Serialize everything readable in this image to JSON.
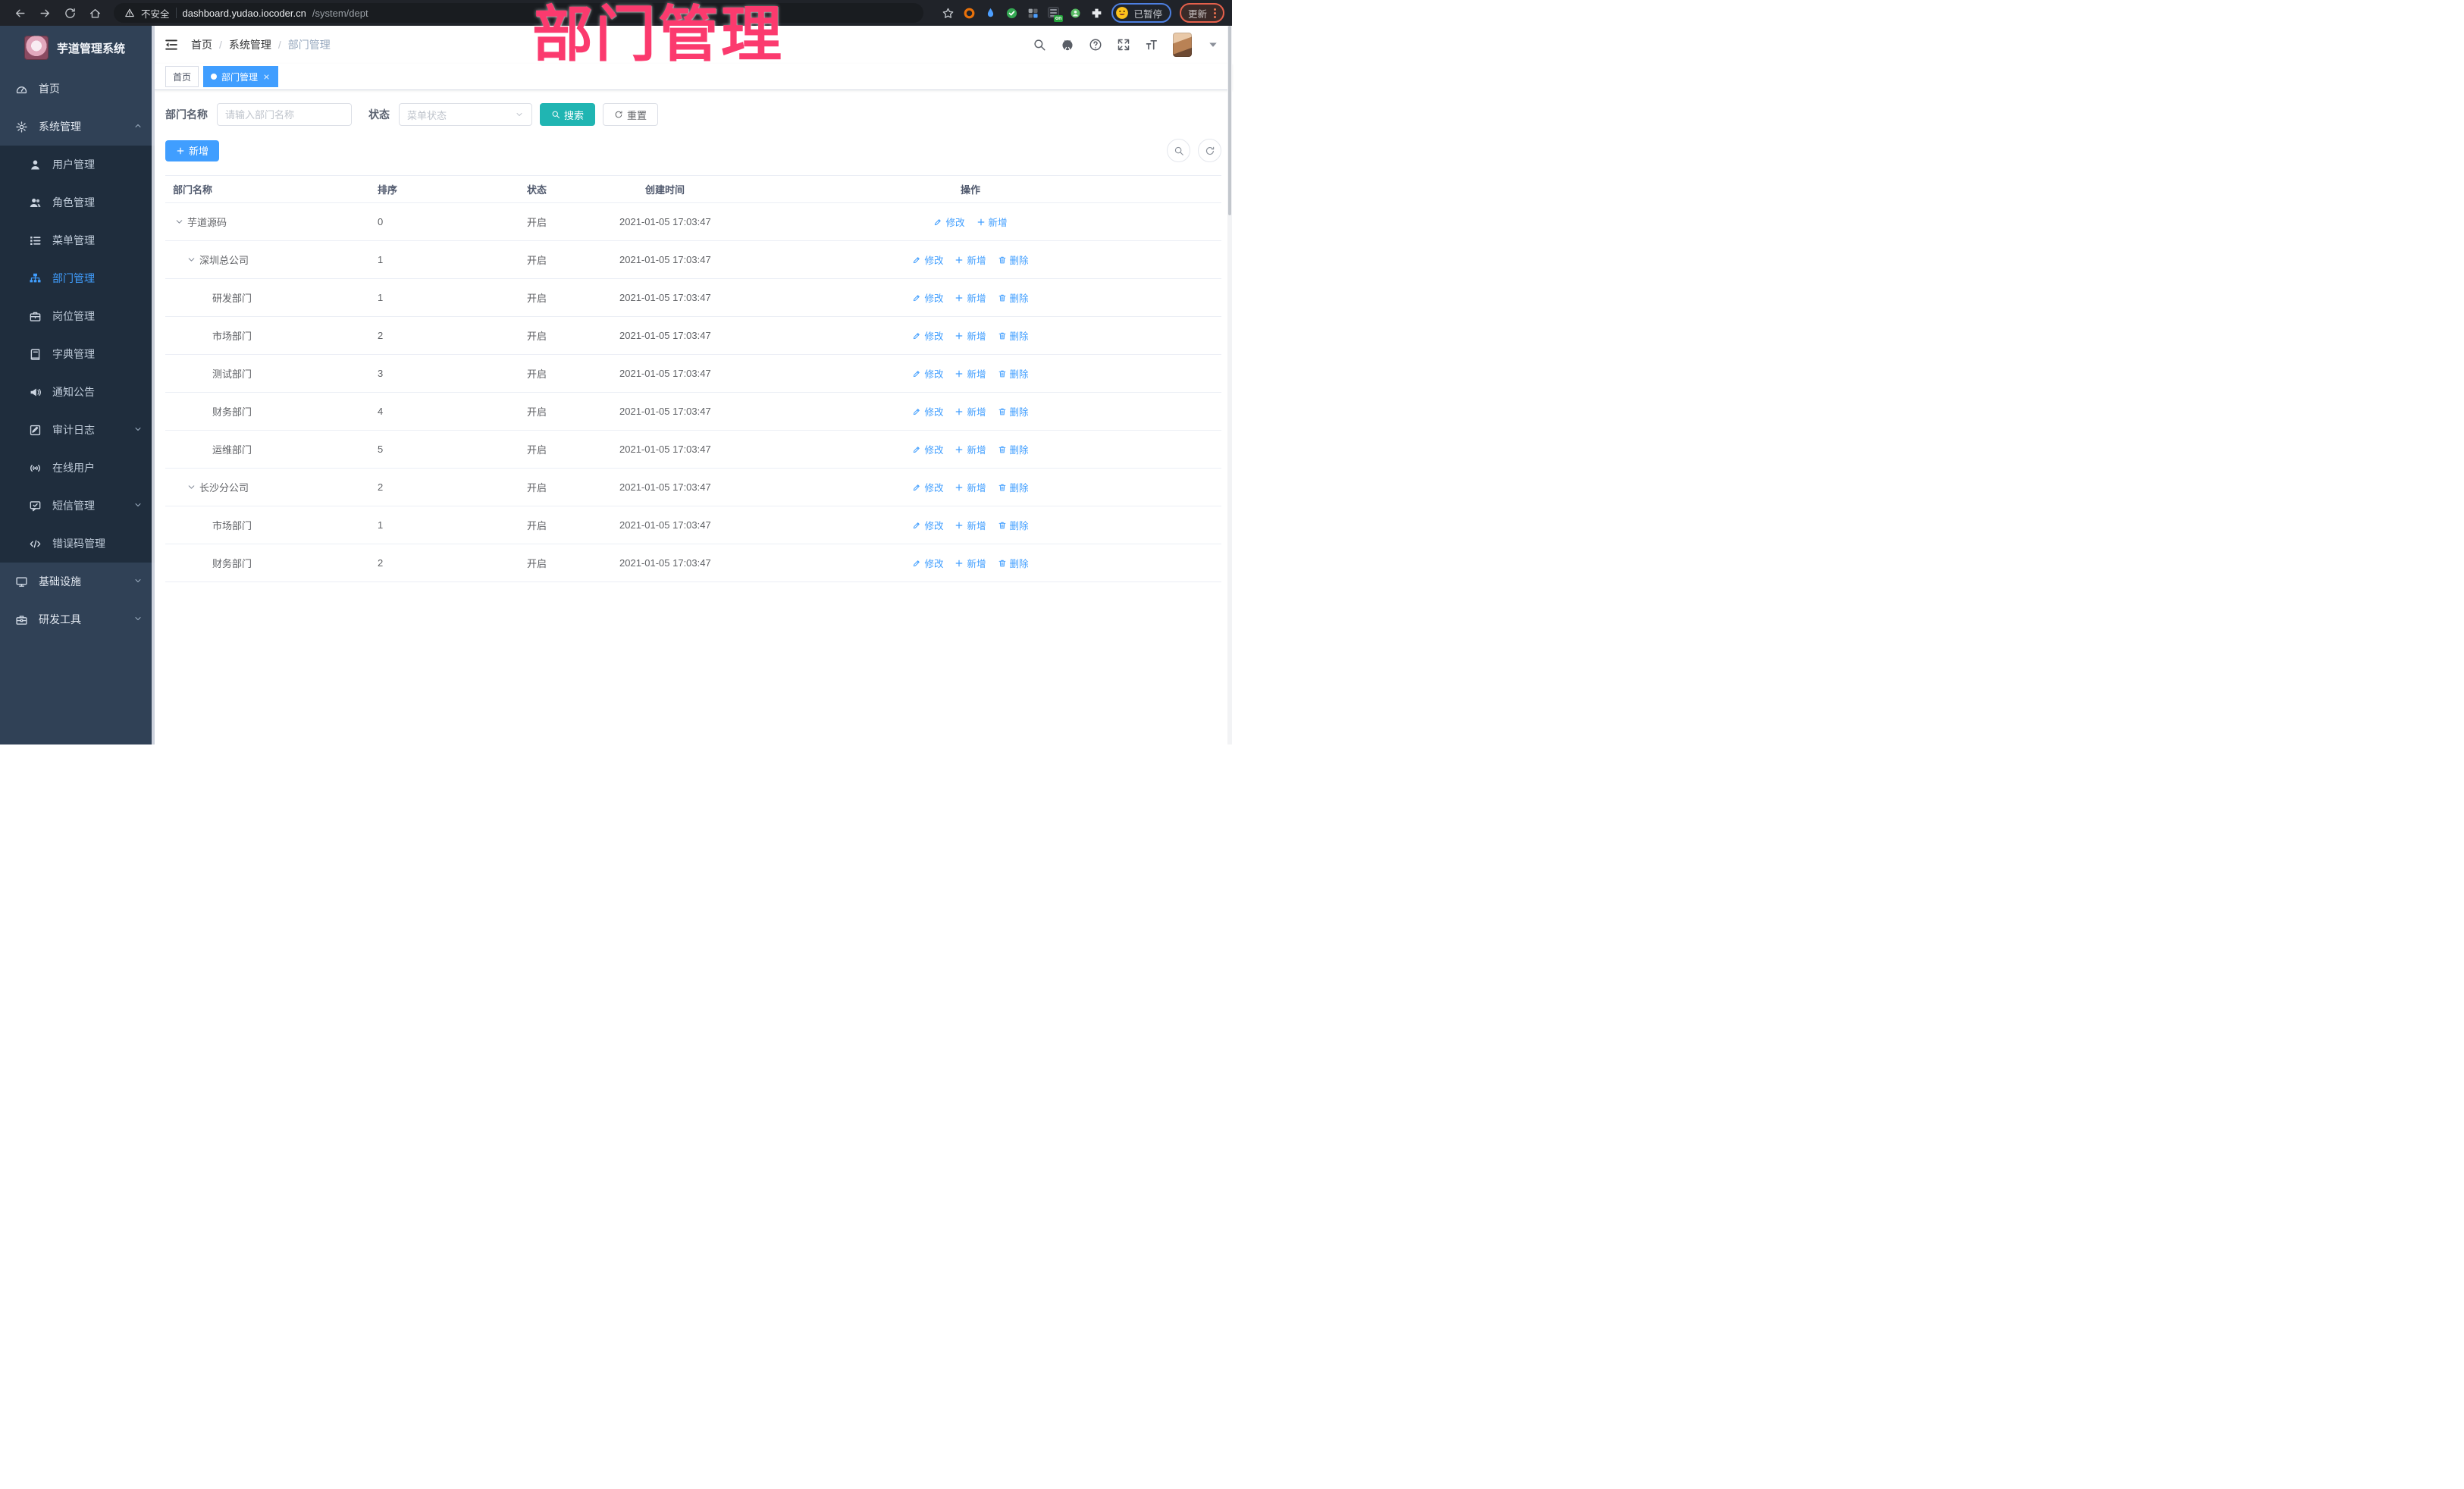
{
  "annotation": {
    "text": "部门管理"
  },
  "browser": {
    "security_label": "不安全",
    "url_host": "dashboard.yudao.iocoder.cn",
    "url_path": "/system/dept",
    "extension_badge": "on",
    "paused_label": "已暂停",
    "update_label": "更新"
  },
  "sidebar": {
    "brand": "芋道管理系统",
    "items": [
      {
        "key": "home",
        "label": "首页",
        "icon": "dashboard-icon",
        "type": "root"
      },
      {
        "key": "system",
        "label": "系统管理",
        "icon": "gear-icon",
        "type": "root",
        "expanded": true,
        "chevron": "up"
      },
      {
        "key": "user",
        "label": "用户管理",
        "icon": "user-icon",
        "type": "sub"
      },
      {
        "key": "role",
        "label": "角色管理",
        "icon": "users-icon",
        "type": "sub"
      },
      {
        "key": "menu",
        "label": "菜单管理",
        "icon": "menu-tree-icon",
        "type": "sub"
      },
      {
        "key": "dept",
        "label": "部门管理",
        "icon": "org-chart-icon",
        "type": "sub",
        "active": true
      },
      {
        "key": "post",
        "label": "岗位管理",
        "icon": "briefcase-icon",
        "type": "sub"
      },
      {
        "key": "dict",
        "label": "字典管理",
        "icon": "dictionary-icon",
        "type": "sub"
      },
      {
        "key": "notice",
        "label": "通知公告",
        "icon": "announcement-icon",
        "type": "sub"
      },
      {
        "key": "audit",
        "label": "审计日志",
        "icon": "audit-log-icon",
        "type": "sub",
        "chevron": "down"
      },
      {
        "key": "online",
        "label": "在线用户",
        "icon": "online-user-icon",
        "type": "sub"
      },
      {
        "key": "sms",
        "label": "短信管理",
        "icon": "sms-icon",
        "type": "sub",
        "chevron": "down"
      },
      {
        "key": "errcode",
        "label": "错误码管理",
        "icon": "error-code-icon",
        "type": "sub"
      },
      {
        "key": "infra",
        "label": "基础设施",
        "icon": "infrastructure-icon",
        "type": "root",
        "chevron": "down"
      },
      {
        "key": "devtools",
        "label": "研发工具",
        "icon": "dev-tools-icon",
        "type": "root",
        "chevron": "down"
      }
    ]
  },
  "header": {
    "breadcrumb": [
      "首页",
      "系统管理",
      "部门管理"
    ]
  },
  "tabs": [
    {
      "label": "首页",
      "active": false
    },
    {
      "label": "部门管理",
      "active": true,
      "closable": true
    }
  ],
  "filters": {
    "dept_label": "部门名称",
    "dept_placeholder": "请输入部门名称",
    "status_label": "状态",
    "status_placeholder": "菜单状态",
    "search_label": "搜索",
    "reset_label": "重置"
  },
  "toolbar": {
    "add_label": "新增"
  },
  "table": {
    "columns": [
      "部门名称",
      "排序",
      "状态",
      "创建时间",
      "操作"
    ],
    "action_labels": {
      "modify": "修改",
      "add": "新增",
      "delete": "删除"
    },
    "rows": [
      {
        "name": "芋道源码",
        "level": 0,
        "expandable": true,
        "sort": "0",
        "status": "开启",
        "created": "2021-01-05 17:03:47",
        "actions": [
          "modify",
          "add"
        ]
      },
      {
        "name": "深圳总公司",
        "level": 1,
        "expandable": true,
        "sort": "1",
        "status": "开启",
        "created": "2021-01-05 17:03:47",
        "actions": [
          "modify",
          "add",
          "delete"
        ]
      },
      {
        "name": "研发部门",
        "level": 2,
        "expandable": false,
        "sort": "1",
        "status": "开启",
        "created": "2021-01-05 17:03:47",
        "actions": [
          "modify",
          "add",
          "delete"
        ]
      },
      {
        "name": "市场部门",
        "level": 2,
        "expandable": false,
        "sort": "2",
        "status": "开启",
        "created": "2021-01-05 17:03:47",
        "actions": [
          "modify",
          "add",
          "delete"
        ]
      },
      {
        "name": "测试部门",
        "level": 2,
        "expandable": false,
        "sort": "3",
        "status": "开启",
        "created": "2021-01-05 17:03:47",
        "actions": [
          "modify",
          "add",
          "delete"
        ]
      },
      {
        "name": "财务部门",
        "level": 2,
        "expandable": false,
        "sort": "4",
        "status": "开启",
        "created": "2021-01-05 17:03:47",
        "actions": [
          "modify",
          "add",
          "delete"
        ]
      },
      {
        "name": "运维部门",
        "level": 2,
        "expandable": false,
        "sort": "5",
        "status": "开启",
        "created": "2021-01-05 17:03:47",
        "actions": [
          "modify",
          "add",
          "delete"
        ]
      },
      {
        "name": "长沙分公司",
        "level": 1,
        "expandable": true,
        "sort": "2",
        "status": "开启",
        "created": "2021-01-05 17:03:47",
        "actions": [
          "modify",
          "add",
          "delete"
        ]
      },
      {
        "name": "市场部门",
        "level": 2,
        "expandable": false,
        "sort": "1",
        "status": "开启",
        "created": "2021-01-05 17:03:47",
        "actions": [
          "modify",
          "add",
          "delete"
        ]
      },
      {
        "name": "财务部门",
        "level": 2,
        "expandable": false,
        "sort": "2",
        "status": "开启",
        "created": "2021-01-05 17:03:47",
        "actions": [
          "modify",
          "add",
          "delete"
        ]
      }
    ]
  },
  "colors": {
    "primary": "#409eff",
    "search_teal": "#20b5b2",
    "annotation_pink": "#fb3a6e",
    "sidebar_bg": "#304156",
    "submenu_bg": "#1f2d3d"
  }
}
